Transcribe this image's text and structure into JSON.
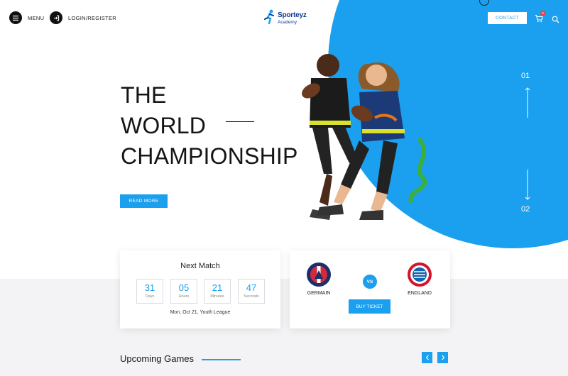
{
  "header": {
    "menu_label": "MENU",
    "login_label": "LOGIN/REGISTER",
    "logo_name": "Sporteyz",
    "logo_sub": "Academy",
    "contact_label": "CONTACT",
    "cart_count": "0"
  },
  "hero": {
    "title_lines": [
      "THE",
      "WORLD",
      "CHAMPIONSHIP"
    ],
    "read_more_label": "READ MORE",
    "slide_prev": "01",
    "slide_next": "02"
  },
  "next_match": {
    "title": "Next Match",
    "countdown": [
      {
        "value": "31",
        "unit": "Days"
      },
      {
        "value": "05",
        "unit": "Hours"
      },
      {
        "value": "21",
        "unit": "Minutes"
      },
      {
        "value": "47",
        "unit": "Seconds"
      }
    ],
    "date": "Mon, Oct 21, Youth League"
  },
  "match": {
    "home": "GERMAIN",
    "away": "ENGLAND",
    "vs": "VS",
    "buy_label": "BUY TICKET"
  },
  "upcoming": {
    "title": "Upcoming Games"
  },
  "colors": {
    "accent": "#1aa0ee",
    "dark": "#111111",
    "band": "#f3f3f5"
  }
}
